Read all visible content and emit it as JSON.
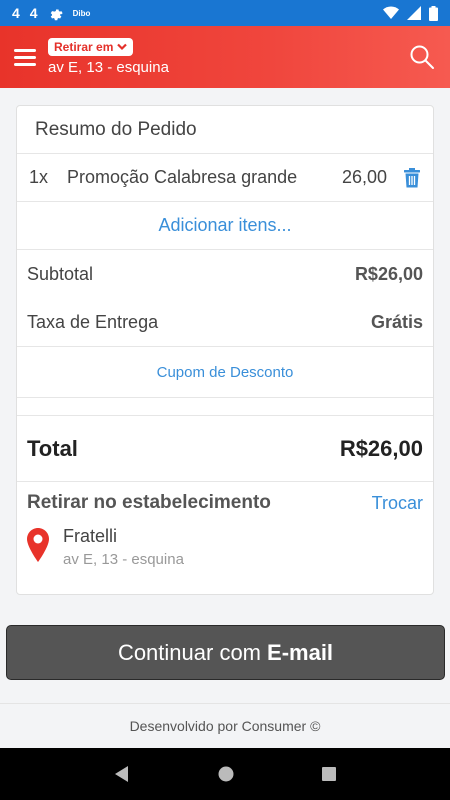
{
  "status_bar": {
    "left_items": [
      "4",
      "4"
    ],
    "dibo_label": "Dibo"
  },
  "header": {
    "pickup_pill": "Retirar em",
    "address": "av E, 13 - esquina"
  },
  "order_summary": {
    "title": "Resumo do Pedido",
    "items": [
      {
        "qty": "1x",
        "name": "Promoção Calabresa grande",
        "price": "26,00"
      }
    ],
    "add_items_link": "Adicionar itens...",
    "subtotal_label": "Subtotal",
    "subtotal_value": "R$26,00",
    "delivery_label": "Taxa de Entrega",
    "delivery_value": "Grátis",
    "coupon_link": "Cupom de Desconto",
    "total_label": "Total",
    "total_value": "R$26,00"
  },
  "pickup": {
    "title": "Retirar no estabelecimento",
    "change_link": "Trocar",
    "store_name": "Fratelli",
    "store_address": "av E, 13 - esquina"
  },
  "cta": {
    "prefix": "Continuar com",
    "bold": "E-mail"
  },
  "footer": {
    "text": "Desenvolvido por Consumer ©"
  },
  "colors": {
    "brand_red": "#e8332a",
    "link_blue": "#3a8fd9",
    "status_blue": "#1976d2",
    "cta_gray": "#555555"
  }
}
